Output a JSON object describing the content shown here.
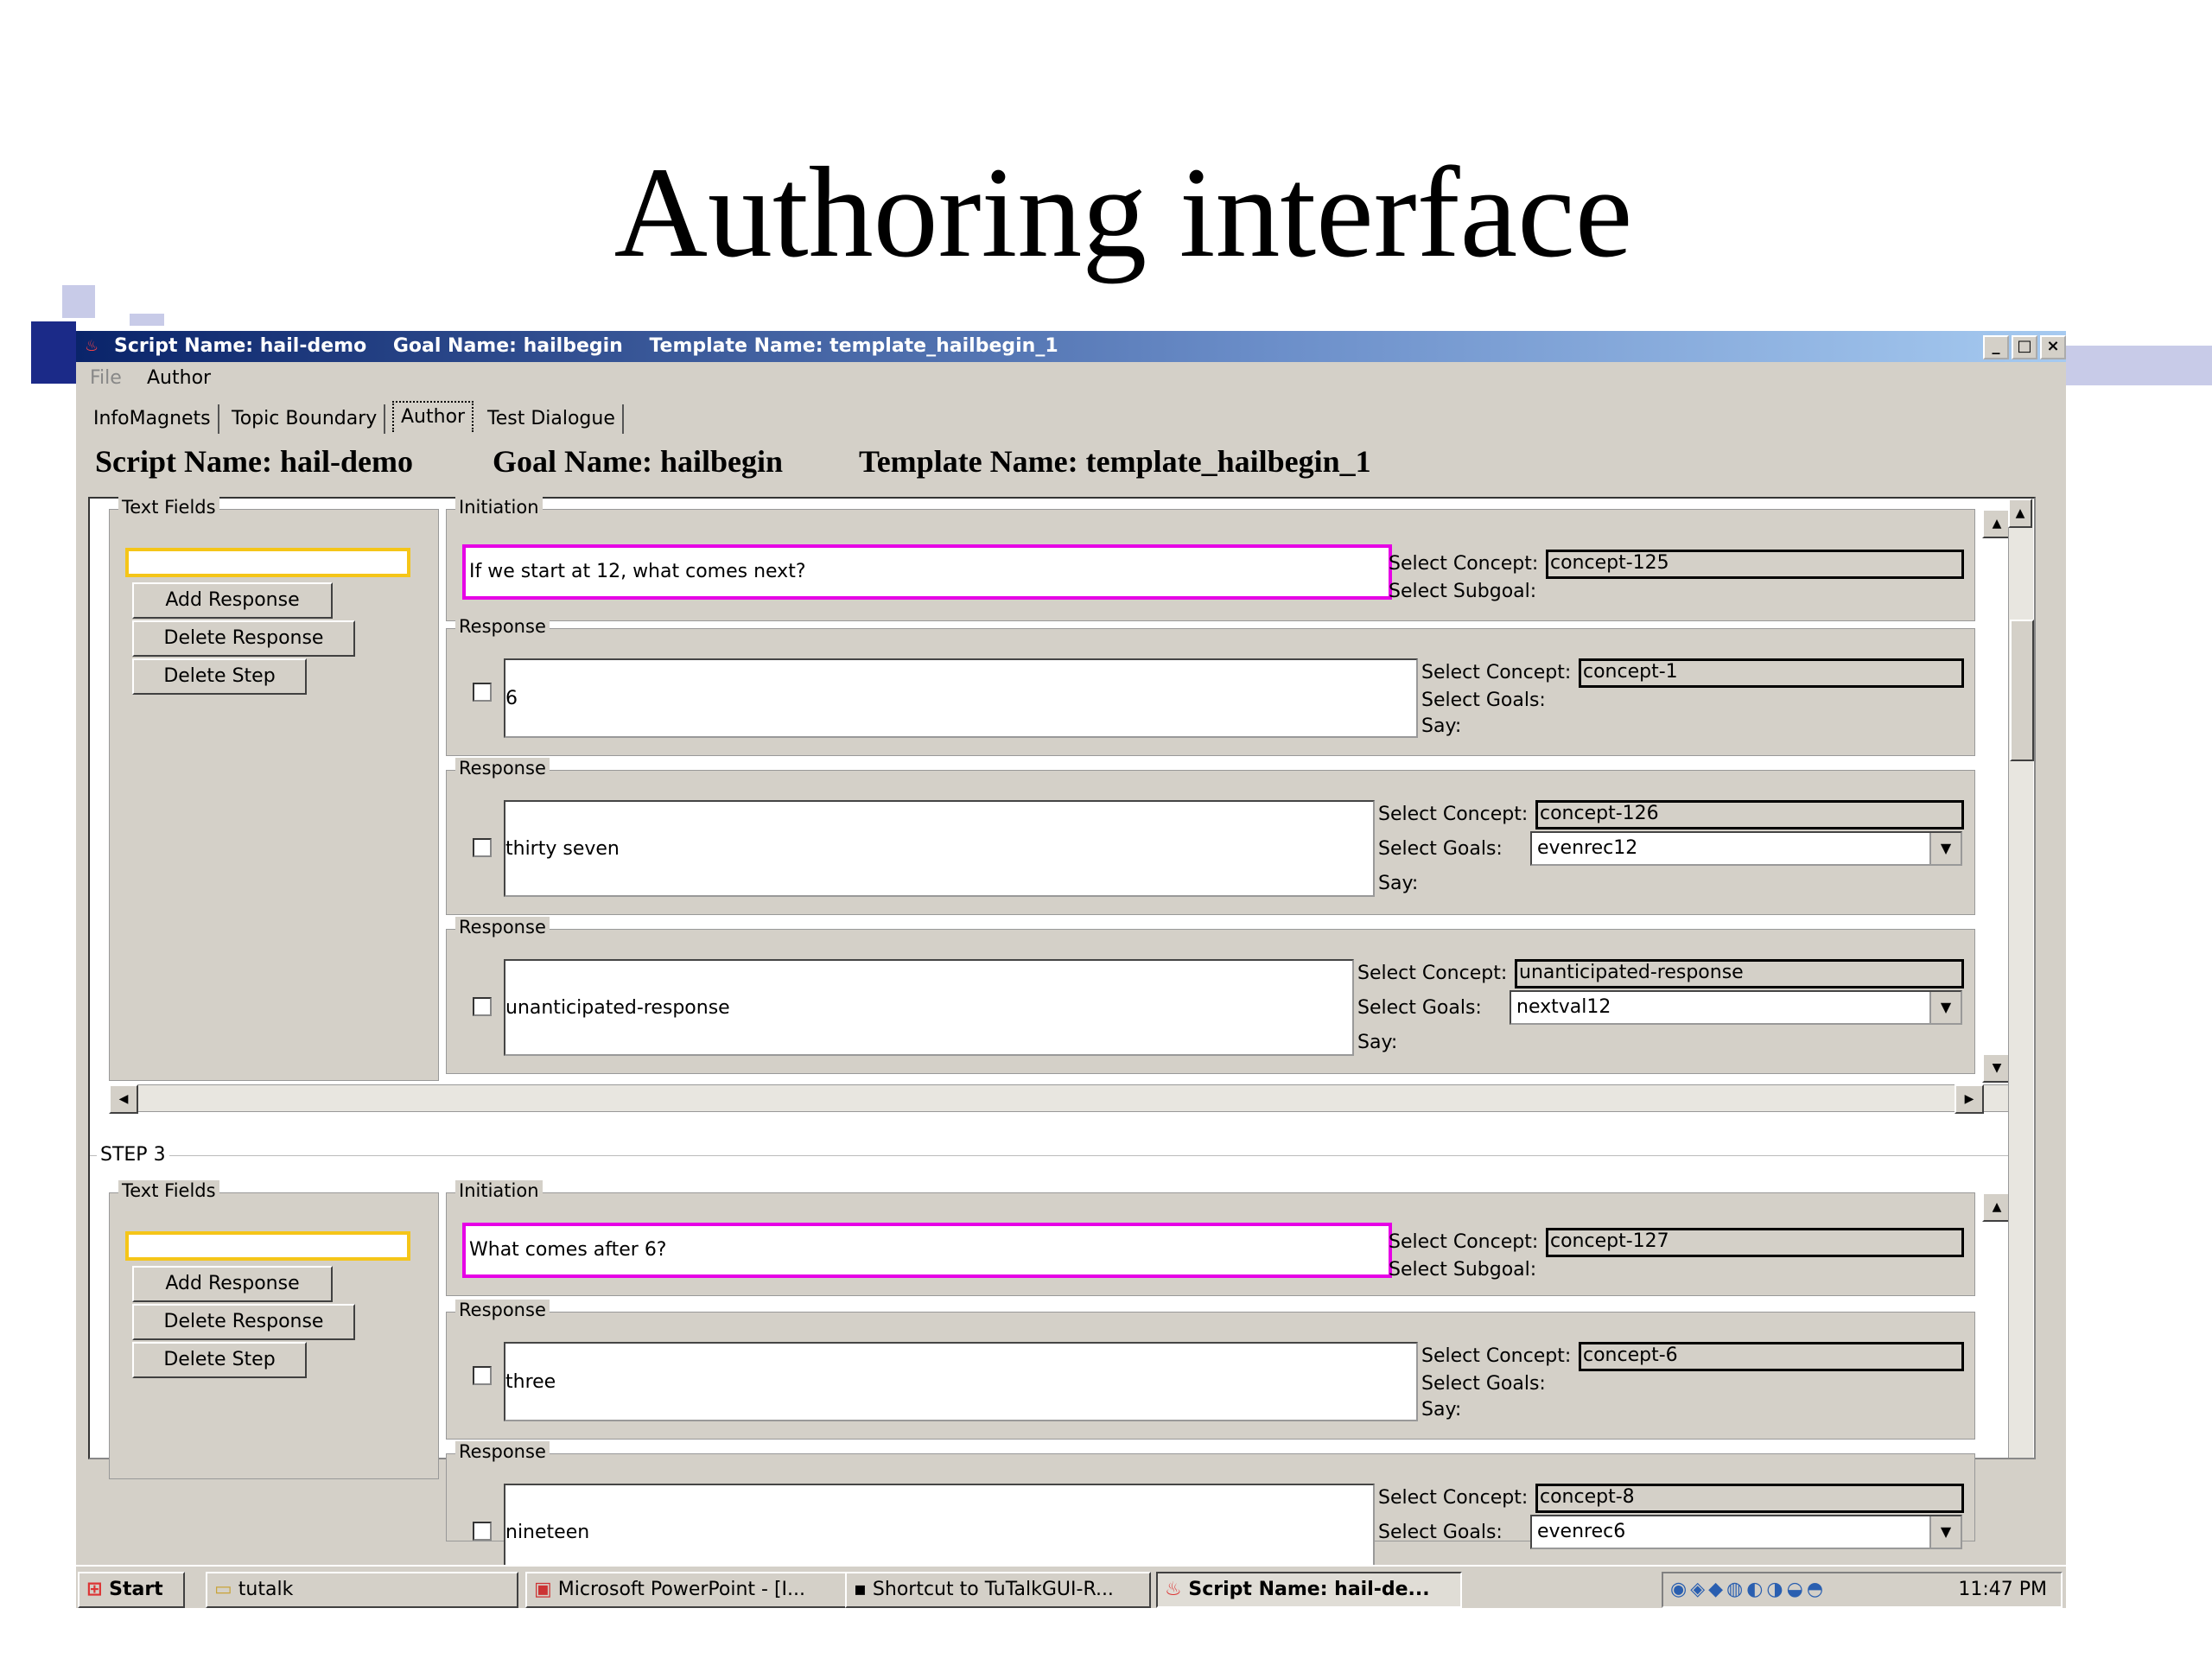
{
  "slide": {
    "title": "Authoring interface"
  },
  "window": {
    "title": "Script Name: hail-demo    Goal Name: hailbegin    Template Name: template_hailbegin_1",
    "controls": [
      "_",
      "□",
      "×"
    ]
  },
  "menu": {
    "file": "File",
    "author": "Author"
  },
  "tabs": [
    "InfoMagnets",
    "Topic Boundary",
    "Author",
    "Test Dialogue"
  ],
  "header": {
    "script": "Script Name: hail-demo",
    "goal": "Goal Name: hailbegin",
    "template": "Template Name: template_hailbegin_1"
  },
  "labels": {
    "text_fields": "Text Fields",
    "initiation": "Initiation",
    "response": "Response",
    "add_response": "Add Response",
    "delete_response": "Delete Response",
    "delete_step": "Delete Step",
    "select_concept": "Select Concept:",
    "select_subgoal": "Select Subgoal:",
    "select_goals": "Select Goals:",
    "say": "Say:"
  },
  "step2": {
    "initiation": {
      "text": "If we start at 12, what comes next?",
      "concept": "concept-125"
    },
    "responses": [
      {
        "text": "6",
        "concept": "concept-1",
        "goal": ""
      },
      {
        "text": "thirty seven",
        "concept": "concept-126",
        "goal": "evenrec12"
      },
      {
        "text": "unanticipated-response",
        "concept": "unanticipated-response",
        "goal": "nextval12"
      }
    ]
  },
  "step3": {
    "label": "STEP 3",
    "initiation": {
      "text": "What comes after 6?",
      "concept": "concept-127"
    },
    "responses": [
      {
        "text": "three",
        "concept": "concept-6",
        "goal": ""
      },
      {
        "text": "nineteen",
        "concept": "concept-8",
        "goal": "evenrec6"
      }
    ]
  },
  "taskbar": {
    "start": "Start",
    "items": [
      "tutalk",
      "Microsoft PowerPoint - [I...",
      "Shortcut to TuTalkGUI-R...",
      "Script Name: hail-de..."
    ],
    "clock": "11:47 PM"
  }
}
